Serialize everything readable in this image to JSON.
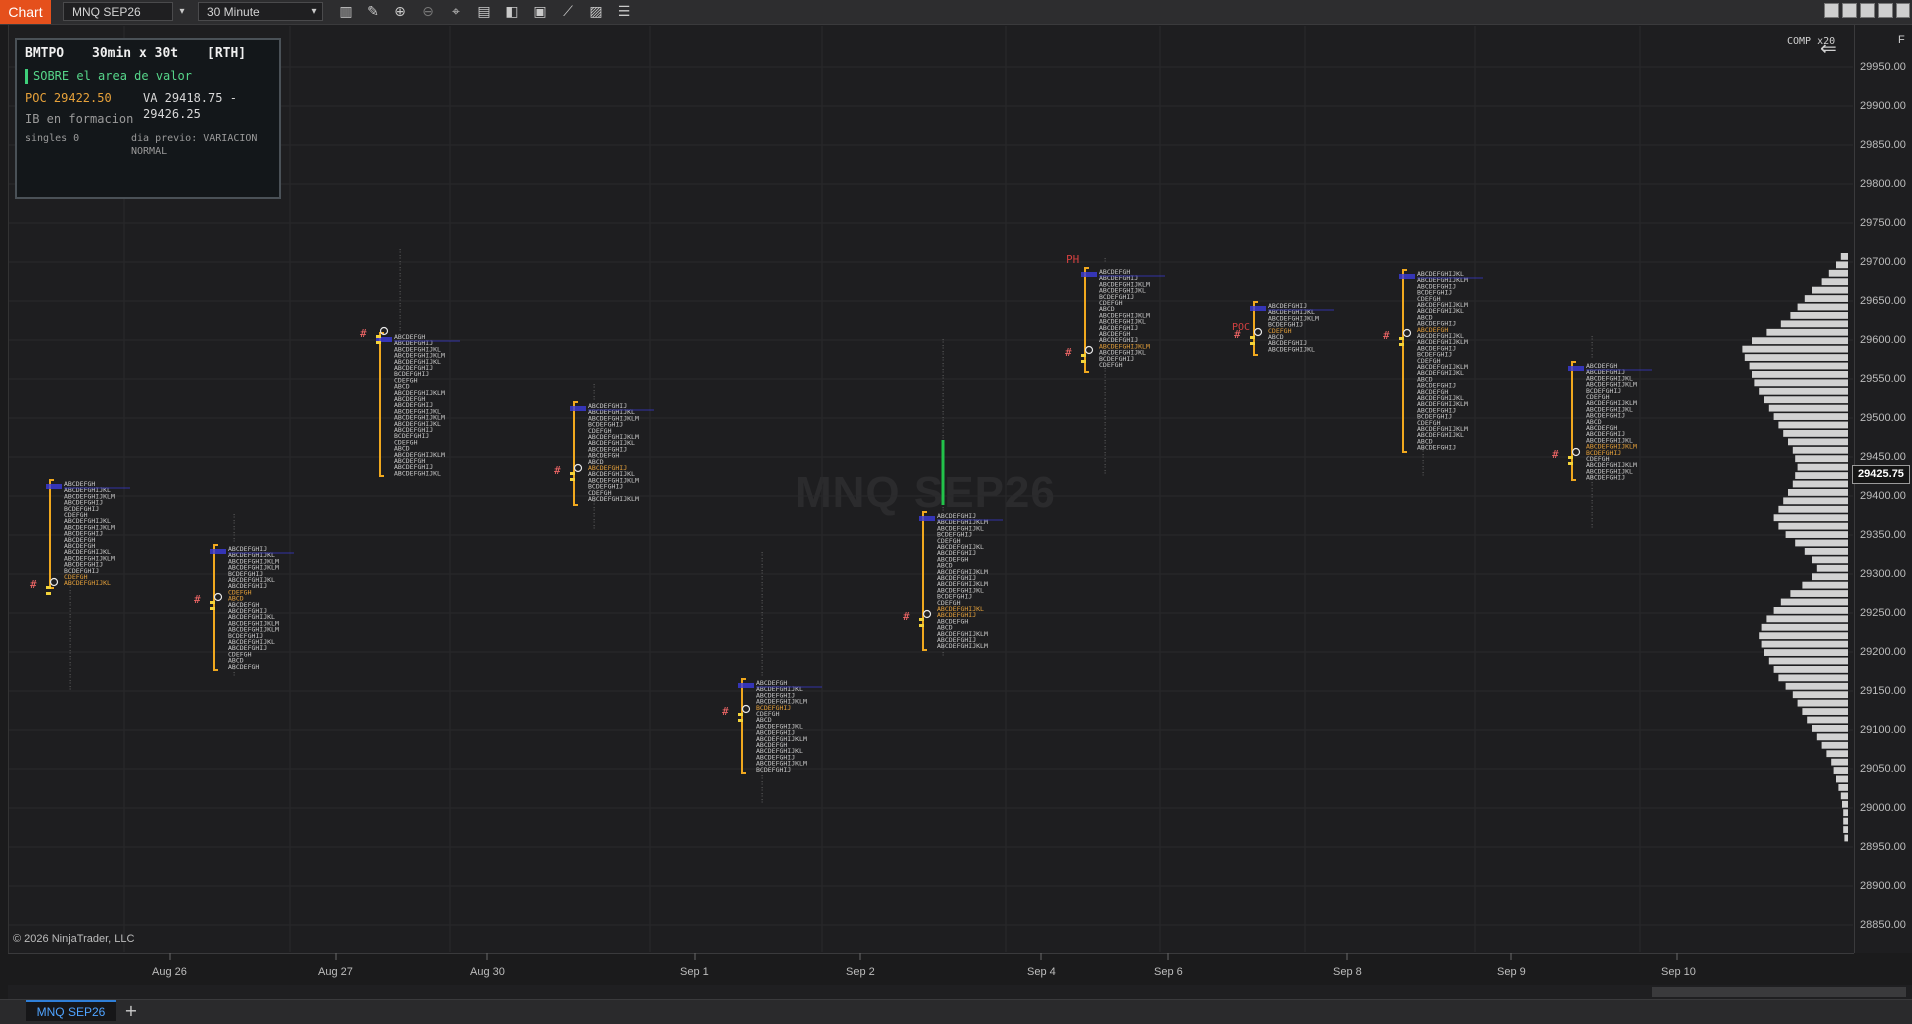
{
  "toolbar": {
    "chart_tab": "Chart",
    "instrument": "MNQ SEP26",
    "interval": "30 Minute"
  },
  "watermark": "MNQ SEP26",
  "copyright": "© 2026 NinjaTrader, LLC",
  "comp_label": "COMP x20",
  "f_label": "F",
  "info_box": {
    "title": "BMTPO",
    "period": "30min x 30t",
    "session": "[RTH]",
    "status": "SOBRE el area de valor",
    "poc": "POC 29422.50",
    "va_line1": "VA 29418.75 -",
    "va_line2": "29426.25",
    "ib": "IB en formacion",
    "singles": "singles  0",
    "prev_line1": "dia previo: VARIACION",
    "prev_line2": "NORMAL"
  },
  "price_axis": [
    "29950.00",
    "29900.00",
    "29850.00",
    "29800.00",
    "29750.00",
    "29700.00",
    "29650.00",
    "29600.00",
    "29550.00",
    "29500.00",
    "29450.00",
    "29400.00",
    "29350.00",
    "29300.00",
    "29250.00",
    "29200.00",
    "29150.00",
    "29100.00",
    "29050.00",
    "29000.00",
    "28950.00",
    "28900.00",
    "28850.00"
  ],
  "current_price": "29425.75",
  "date_axis": [
    "Aug 26",
    "Aug 27",
    "Aug 30",
    "Sep 1",
    "Sep 2",
    "Sep 4",
    "Sep 6",
    "Sep 8",
    "Sep 9",
    "Sep 10"
  ],
  "annotations": {
    "ph": "PH",
    "poc": "POC",
    "hash": "#"
  },
  "bottom_tab": "MNQ SEP26",
  "colors": {
    "accent": "#e5501c",
    "va_bracket": "#f0a81e",
    "poc_text": "#e6a13a",
    "tpo_text": "#c9c9c9",
    "hash_mark": "#ff6b6b",
    "status_bar": "#3ecf7a",
    "blue_level": "#3b3bdc",
    "green_ib": "#22c24a",
    "volume_bar": "#d2d2d2"
  },
  "tpo_rows": {
    "a": "ABCDEFGH",
    "b": "ABCDEFGHIJ",
    "c": "ABCDEFGHIJKL",
    "d": "ABCDEFGHIJKLM",
    "e": "BCDEFGHIJ",
    "f": "CDEFGH",
    "g": "ABCD"
  },
  "volume_profile": [
    0.06,
    0.1,
    0.16,
    0.22,
    0.3,
    0.36,
    0.42,
    0.48,
    0.56,
    0.68,
    0.8,
    0.88,
    0.86,
    0.82,
    0.8,
    0.78,
    0.74,
    0.7,
    0.66,
    0.62,
    0.58,
    0.54,
    0.5,
    0.46,
    0.44,
    0.42,
    0.44,
    0.46,
    0.5,
    0.54,
    0.58,
    0.62,
    0.58,
    0.52,
    0.44,
    0.36,
    0.3,
    0.26,
    0.3,
    0.38,
    0.48,
    0.56,
    0.62,
    0.68,
    0.72,
    0.74,
    0.72,
    0.7,
    0.66,
    0.62,
    0.58,
    0.52,
    0.46,
    0.42,
    0.38,
    0.34,
    0.3,
    0.26,
    0.22,
    0.18,
    0.14,
    0.12,
    0.1,
    0.08,
    0.06,
    0.05,
    0.04,
    0.04,
    0.04,
    0.03
  ]
}
